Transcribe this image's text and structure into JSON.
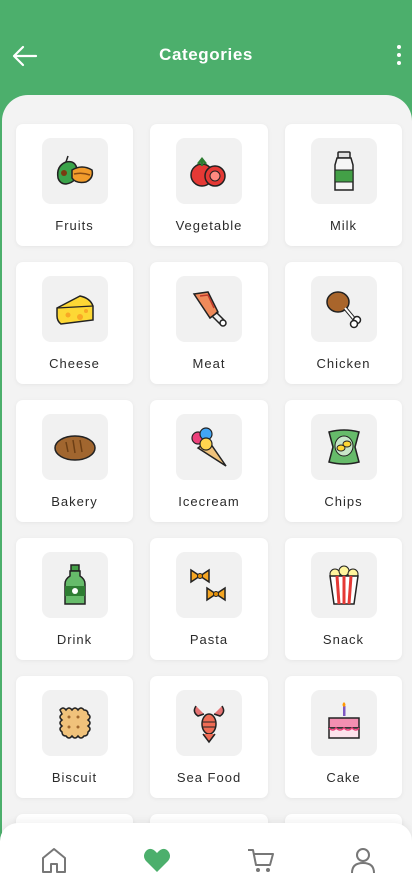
{
  "header": {
    "title": "Categories"
  },
  "categories": [
    {
      "label": "Fruits",
      "icon": "fruits-icon"
    },
    {
      "label": "Vegetable",
      "icon": "vegetable-icon"
    },
    {
      "label": "Milk",
      "icon": "milk-icon"
    },
    {
      "label": "Cheese",
      "icon": "cheese-icon"
    },
    {
      "label": "Meat",
      "icon": "meat-icon"
    },
    {
      "label": "Chicken",
      "icon": "chicken-icon"
    },
    {
      "label": "Bakery",
      "icon": "bread-icon"
    },
    {
      "label": "Icecream",
      "icon": "icecream-icon"
    },
    {
      "label": "Chips",
      "icon": "chips-icon"
    },
    {
      "label": "Drink",
      "icon": "drink-icon"
    },
    {
      "label": "Pasta",
      "icon": "pasta-icon"
    },
    {
      "label": "Snack",
      "icon": "popcorn-icon"
    },
    {
      "label": "Biscuit",
      "icon": "biscuit-icon"
    },
    {
      "label": "Sea Food",
      "icon": "lobster-icon"
    },
    {
      "label": "Cake",
      "icon": "cake-icon"
    }
  ],
  "bottom_nav": [
    {
      "name": "home",
      "icon": "home-icon",
      "active": false
    },
    {
      "name": "favorites",
      "icon": "heart-icon",
      "active": true
    },
    {
      "name": "cart",
      "icon": "cart-icon",
      "active": false
    },
    {
      "name": "profile",
      "icon": "profile-icon",
      "active": false
    }
  ],
  "colors": {
    "primary": "#4caf6c",
    "panel": "#f3f3f3",
    "text": "#2b2b2b",
    "inactive_icon": "#777777"
  }
}
